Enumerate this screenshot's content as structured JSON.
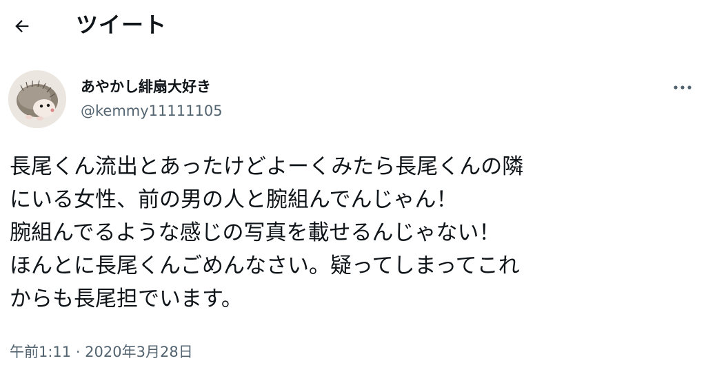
{
  "header": {
    "back_icon": "arrow-left-icon",
    "title": "ツイート"
  },
  "tweet": {
    "avatar": "hedgehog-avatar",
    "display_name": "あやかし緋扇大好き",
    "username": "@kemmy11111105",
    "more_icon": "more-horizontal-icon",
    "text_lines": [
      "長尾くん流出とあったけどよーくみたら長尾くんの隣",
      "にいる女性、前の男の人と腕組んでんじゃん！",
      "腕組んでるような感じの写真を載せるんじゃない！",
      "ほんとに長尾くんごめんなさい。疑ってしまってこれ",
      "からも長尾担でいます。"
    ],
    "timestamp": "午前1:11 · 2020年3月28日"
  }
}
